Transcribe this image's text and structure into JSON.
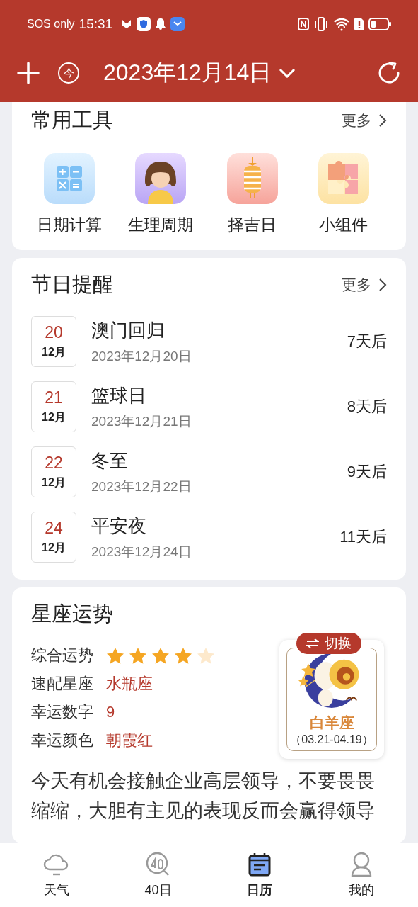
{
  "status_bar": {
    "carrier": "SOS only",
    "time": "15:31"
  },
  "header": {
    "date": "2023年12月14日",
    "today_badge": "今"
  },
  "tools": {
    "title": "常用工具",
    "more": "更多",
    "items": [
      {
        "label": "日期计算",
        "kind": "calculator"
      },
      {
        "label": "生理周期",
        "kind": "person"
      },
      {
        "label": "择吉日",
        "kind": "lantern"
      },
      {
        "label": "小组件",
        "kind": "puzzle"
      }
    ]
  },
  "holidays": {
    "title": "节日提醒",
    "more": "更多",
    "items": [
      {
        "day": "20",
        "month": "12月",
        "name": "澳门回归",
        "date": "2023年12月20日",
        "countdown": "7天后"
      },
      {
        "day": "21",
        "month": "12月",
        "name": "篮球日",
        "date": "2023年12月21日",
        "countdown": "8天后"
      },
      {
        "day": "22",
        "month": "12月",
        "name": "冬至",
        "date": "2023年12月22日",
        "countdown": "9天后"
      },
      {
        "day": "24",
        "month": "12月",
        "name": "平安夜",
        "date": "2023年12月24日",
        "countdown": "11天后"
      }
    ]
  },
  "horoscope": {
    "title": "星座运势",
    "rows": [
      {
        "kind": "stars",
        "label": "综合运势",
        "stars": 4
      },
      {
        "kind": "text",
        "label": "速配星座",
        "value": "水瓶座"
      },
      {
        "kind": "text",
        "label": "幸运数字",
        "value": "9"
      },
      {
        "kind": "text",
        "label": "幸运颜色",
        "value": "朝霞红"
      }
    ],
    "switch_button": "切换",
    "sign": {
      "name": "白羊座",
      "range": "（03.21-04.19）"
    },
    "text": "今天有机会接触企业高层领导，不要畏畏缩缩，大胆有主见的表现反而会赢得领导"
  },
  "bottom_nav": [
    {
      "label": "天气",
      "kind": "weather",
      "selected": false
    },
    {
      "label": "40日",
      "kind": "forty",
      "selected": false
    },
    {
      "label": "日历",
      "kind": "calendar",
      "selected": true
    },
    {
      "label": "我的",
      "kind": "profile",
      "selected": false
    }
  ]
}
